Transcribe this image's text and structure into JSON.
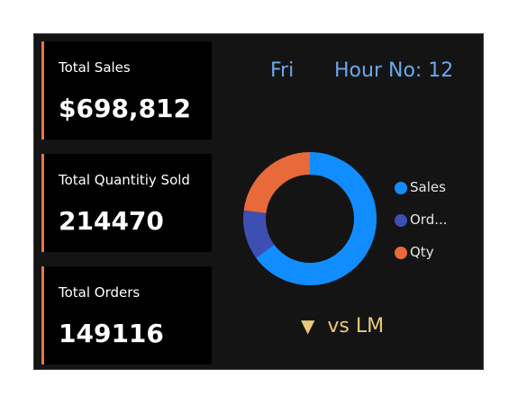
{
  "kpis": [
    {
      "label": "Total Sales",
      "value": "$698,812"
    },
    {
      "label": "Total Quantitiy Sold",
      "value": "214470"
    },
    {
      "label": "Total Orders",
      "value": "149116"
    }
  ],
  "header": {
    "day": "Fri",
    "hour": "Hour No: 12"
  },
  "chart_data": {
    "type": "pie",
    "categories": [
      "Sales",
      "Ord...",
      "Qty"
    ],
    "values": [
      65,
      12,
      23
    ],
    "colors": [
      "#118dff",
      "#3e4fb3",
      "#e8693a"
    ],
    "legend_position": "right"
  },
  "legend": [
    {
      "label": "Sales",
      "color": "#118dff"
    },
    {
      "label": "Ord...",
      "color": "#3e4fb3"
    },
    {
      "label": "Qty",
      "color": "#e8693a"
    }
  ],
  "comparison": {
    "arrow": "▼",
    "label": "vs LM",
    "color": "#e9c97a"
  }
}
